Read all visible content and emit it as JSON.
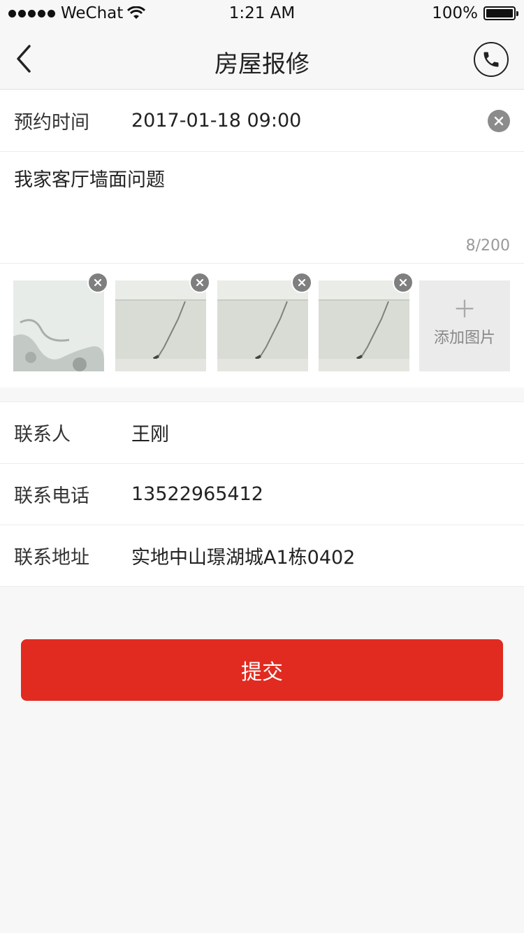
{
  "status_bar": {
    "carrier": "WeChat",
    "time": "1:21 AM",
    "battery": "100%"
  },
  "nav": {
    "title": "房屋报修",
    "back_icon": "chevron-left-icon",
    "phone_icon": "phone-icon"
  },
  "appointment": {
    "label": "预约时间",
    "value": "2017-01-18 09:00"
  },
  "description": {
    "text": "我家客厅墙面问题",
    "counter": "8/200"
  },
  "photos": {
    "add_label": "添加图片",
    "add_icon": "plus-icon"
  },
  "contact": {
    "person_label": "联系人",
    "person_value": "王刚",
    "phone_label": "联系电话",
    "phone_value": "13522965412",
    "address_label": "联系地址",
    "address_value": "实地中山璟湖城A1栋0402"
  },
  "submit_label": "提交",
  "colors": {
    "accent": "#e12b20",
    "background": "#f7f7f7"
  }
}
